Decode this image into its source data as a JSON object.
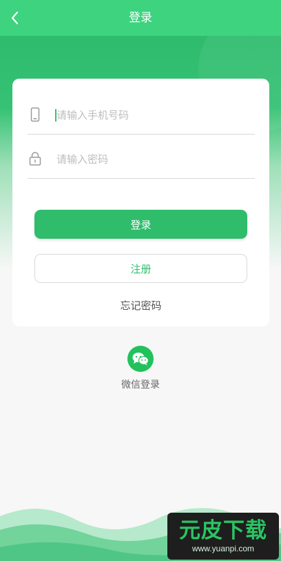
{
  "header": {
    "title": "登录",
    "back_icon": "chevron-left-icon"
  },
  "form": {
    "phone_placeholder": "请输入手机号码",
    "password_placeholder": "请输入密码",
    "login_button": "登录",
    "register_button": "注册",
    "forgot_password": "忘记密码"
  },
  "social": {
    "wechat_label": "微信登录",
    "wechat_icon": "wechat-icon"
  },
  "watermark": {
    "brand": "元皮下载",
    "url": "www.yuanpi.com"
  },
  "colors": {
    "primary": "#2fbc6b",
    "header": "#3dd37f",
    "wechat": "#21c25c"
  }
}
